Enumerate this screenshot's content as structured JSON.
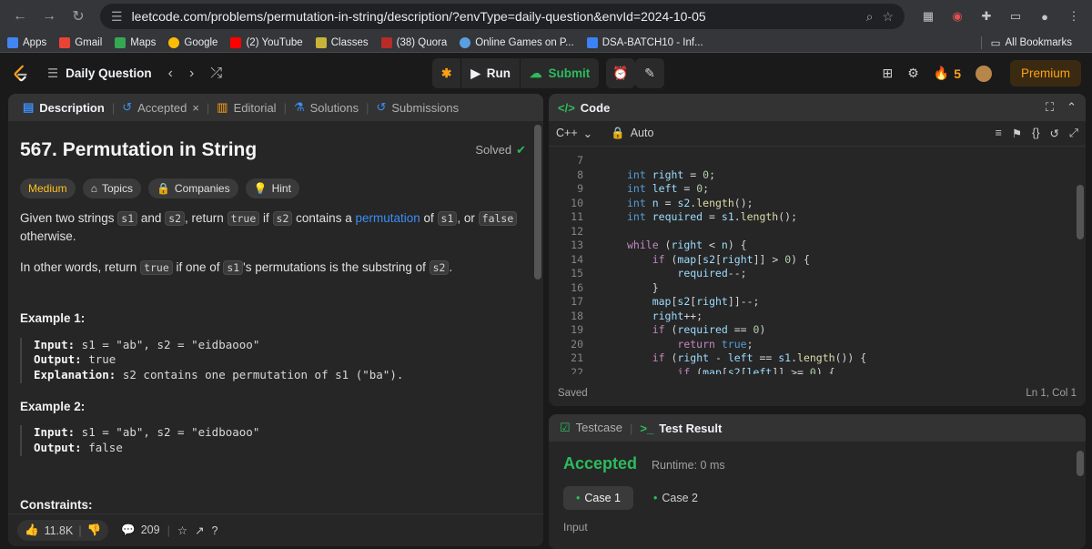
{
  "browser": {
    "url": "leetcode.com/problems/permutation-in-string/description/?envType=daily-question&envId=2024-10-05",
    "bookmarks": [
      "Apps",
      "Gmail",
      "Maps",
      "Google",
      "(2) YouTube",
      "Classes",
      "(38) Quora",
      "Online Games on P...",
      "DSA-BATCH10 - Inf..."
    ],
    "all_bookmarks": "All Bookmarks"
  },
  "topbar": {
    "daily_label": "Daily Question",
    "run_label": "Run",
    "submit_label": "Submit",
    "streak": "5",
    "premium": "Premium"
  },
  "left_tabs": [
    "Description",
    "Accepted",
    "Editorial",
    "Solutions",
    "Submissions"
  ],
  "problem": {
    "title": "567. Permutation in String",
    "solved": "Solved",
    "difficulty": "Medium",
    "chips": [
      "Topics",
      "Companies",
      "Hint"
    ],
    "p1": {
      "a": "Given two strings ",
      "c1": "s1",
      "b": " and ",
      "c2": "s2",
      "c": ", return ",
      "c3": "true",
      "d": " if ",
      "c4": "s2",
      "e": " contains a ",
      "link": "permutation",
      "f": " of ",
      "c5": "s1",
      "g": ", or ",
      "c6": "false",
      "h": " otherwise."
    },
    "p2": {
      "a": "In other words, return ",
      "c1": "true",
      "b": " if one of ",
      "c2": "s1",
      "c": "'s permutations is the substring of ",
      "c3": "s2",
      "d": "."
    },
    "example1": {
      "heading": "Example 1:",
      "input_label": "Input:",
      "input": " s1 = \"ab\", s2 = \"eidbaooo\"",
      "output_label": "Output:",
      "output": " true",
      "exp_label": "Explanation:",
      "exp": " s2 contains one permutation of s1 (\"ba\")."
    },
    "example2": {
      "heading": "Example 2:",
      "input_label": "Input:",
      "input": " s1 = \"ab\", s2 = \"eidboaoo\"",
      "output_label": "Output:",
      "output": " false"
    },
    "constraints": "Constraints:"
  },
  "footer": {
    "likes": "11.8K",
    "comments": "209"
  },
  "code_panel": {
    "title": "Code",
    "language": "C++",
    "autosave": "Auto",
    "saved": "Saved",
    "cursor": "Ln 1, Col 1",
    "line_numbers": [
      "7",
      "8",
      "9",
      "10",
      "11",
      "12",
      "13",
      "14",
      "15",
      "16",
      "17",
      "18",
      "19",
      "20",
      "21",
      "22"
    ]
  },
  "results": {
    "testcase_tab": "Testcase",
    "result_tab": "Test Result",
    "status": "Accepted",
    "runtime": "Runtime: 0 ms",
    "cases": [
      "Case 1",
      "Case 2"
    ],
    "input_label": "Input"
  },
  "colors": {
    "accent_green": "#2cbb5d",
    "premium": "#ffa116",
    "link_blue": "#3b8ef6"
  }
}
